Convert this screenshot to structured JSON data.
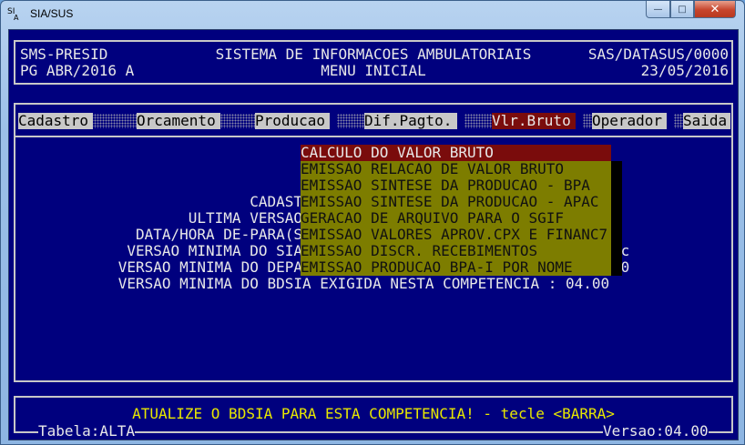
{
  "window": {
    "title": "SIA/SUS",
    "icon": {
      "name": "sia-app-icon",
      "main": "SI",
      "sub": "A"
    },
    "controls": {
      "minimize": "—",
      "maximize": "□",
      "close": "✕"
    }
  },
  "header": {
    "left_line1": "SMS-PRESID",
    "left_line2": "PG ABR/2016 A",
    "center_line1": "SISTEMA DE INFORMACOES AMBULATORIAIS",
    "center_line2": "MENU INICIAL",
    "right_line1": "SAS/DATASUS/0000",
    "right_line2": "23/05/2016"
  },
  "menu": {
    "items": [
      {
        "label": "Cadastro"
      },
      {
        "label": "Orcamento"
      },
      {
        "label": "Producao"
      },
      {
        "label": "Dif.Pagto."
      },
      {
        "label": "Vlr.Bruto",
        "selected": true
      },
      {
        "label": "Operador"
      },
      {
        "label": "Saida"
      }
    ]
  },
  "background_lines": {
    "l1": "CADAST",
    "l2": "ULTIMA VERSAO",
    "l3": "DATA/HORA DE-PARA(S",
    "l4": "VERSAO MINIMA DO SIA",
    "l4_tail": "*c",
    "l5": "VERSAO MINIMA DO DEPA",
    "l5_tail": "00",
    "l6": "VERSAO MINIMA DO BDSI",
    "l6_tail": "A EXIGIDA NESTA COMPETENCIA : 04.00"
  },
  "dropdown": {
    "items": [
      "CALCULO DO VALOR BRUTO",
      "EMISSAO RELACAO DE VALOR BRUTO",
      "EMISSAO SINTESE DA PRODUCAO - BPA",
      "EMISSAO SINTESE DA PRODUCAO - APAC",
      "GERACAO DE ARQUIVO PARA O SGIF",
      "EMISSAO VALORES APROV.CPX E FINANC7",
      "EMISSAO DISCR. RECEBIMENTOS",
      "EMISSAO PRODUCAO BPA-I POR NOME"
    ]
  },
  "status": {
    "message": "ATUALIZE O BDSIA PARA ESTA COMPETENCIA! - tecle <BARRA>",
    "table_label": "Tabela:ALTA",
    "version_label": "Versao:04.00"
  },
  "colors": {
    "console_bg": "#00007e",
    "menu_bg": "#c8c8c8",
    "selected_bg": "#7a0c0c",
    "dropdown_bg": "#7d7d00",
    "status_fg": "#e8e800"
  }
}
